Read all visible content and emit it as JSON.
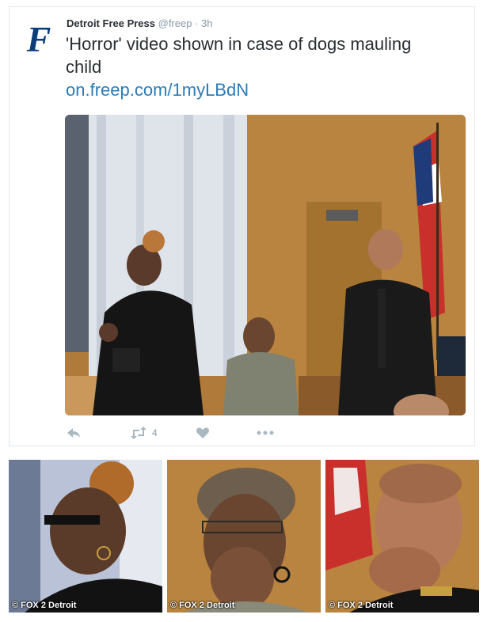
{
  "tweet": {
    "author": "Detroit Free Press",
    "handle": "@freep",
    "separator": "·",
    "time": "3h",
    "text": "'Horror' video shown in case of dogs mauling child",
    "link": "on.freep.com/1myLBdN",
    "logo_letter": "F",
    "logo_color": "#0a3d7a",
    "link_color": "#2b7bb9",
    "actions": {
      "reply_icon": "reply-icon",
      "retweet_icon": "retweet-icon",
      "retweet_count": "4",
      "like_icon": "heart-icon",
      "more_icon": "more-icon"
    }
  },
  "thumbnails": [
    {
      "caption": "© FOX 2 Detroit"
    },
    {
      "caption": "© FOX 2 Detroit"
    },
    {
      "caption": "© FOX 2 Detroit"
    }
  ]
}
